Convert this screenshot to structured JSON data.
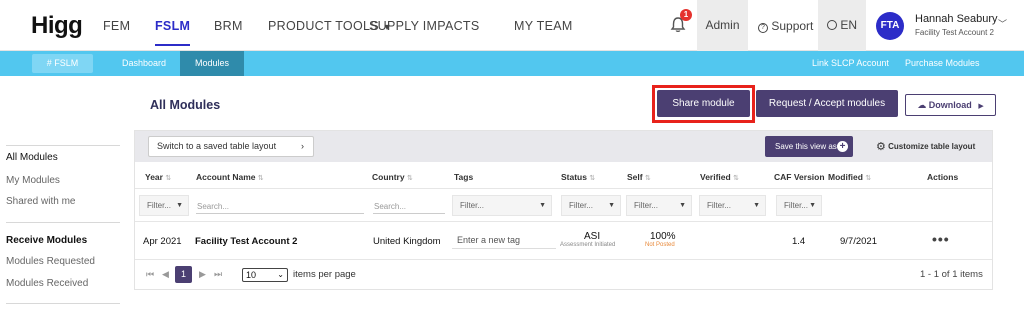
{
  "topnav": {
    "logo": "Higg",
    "links": [
      "FEM",
      "FSLM",
      "BRM",
      "PRODUCT TOOLS",
      "SUPPLY IMPACTS",
      "MY TEAM"
    ],
    "notification_count": "1",
    "admin_label": "Admin",
    "support_label": "Support",
    "language_label": "EN",
    "user_initials": "FTA",
    "user_name": "Hannah Seabury",
    "user_account": "Facility Test Account 2"
  },
  "subnav": {
    "brand": "FSLM",
    "links": [
      "Dashboard",
      "Modules"
    ],
    "right_links": [
      "Link SLCP Account",
      "Purchase Modules"
    ]
  },
  "sidebar": {
    "items": [
      "All Modules",
      "My Modules",
      "Shared with me"
    ],
    "section_title": "Receive Modules",
    "section_items": [
      "Modules Requested",
      "Modules Received"
    ]
  },
  "main": {
    "title": "All Modules",
    "share_label": "Share module",
    "request_label": "Request / Accept modules",
    "download_label": "Download",
    "layout_label": "Switch to a saved table layout",
    "save_view_label": "Save this view as",
    "customize_label": "Customize table layout"
  },
  "table": {
    "headers": [
      "Year",
      "Account Name",
      "Country",
      "Tags",
      "Status",
      "Self",
      "Verified",
      "CAF Version",
      "Modified",
      "Actions"
    ],
    "filter_placeholder": "Filter...",
    "search_placeholder": "Search...",
    "row": {
      "year": "Apr 2021",
      "account": "Facility Test Account 2",
      "country": "United Kingdom",
      "tag_placeholder": "Enter a new tag",
      "status": "ASI",
      "status_sub": "Assessment Initiated",
      "self": "100%",
      "self_sub": "Not Posted",
      "caf_version": "1.4",
      "modified": "9/7/2021"
    }
  },
  "pagination": {
    "current_page": "1",
    "per_page": "10",
    "per_page_label": "items per page",
    "count_text": "1 - 1 of 1 items"
  },
  "colors": {
    "accent_purple": "#4b3f72",
    "subnav_blue": "#52c7ef",
    "active_nav": "#2c2cc8",
    "highlight_red": "#e8221b"
  }
}
